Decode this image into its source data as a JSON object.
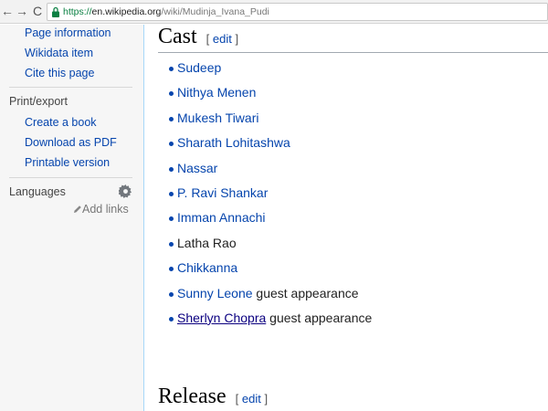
{
  "browser": {
    "back_glyph": "←",
    "forward_glyph": "→",
    "reload_glyph": "C",
    "url_scheme": "https://",
    "url_host": "en.wikipedia.org",
    "url_path": "/wiki/Mudinja_Ivana_Pudi"
  },
  "sidebar": {
    "tools_links": [
      "Page information",
      "Wikidata item",
      "Cite this page"
    ],
    "print_heading": "Print/export",
    "print_links": [
      "Create a book",
      "Download as PDF",
      "Printable version"
    ],
    "languages_heading": "Languages",
    "add_links": "Add links"
  },
  "content": {
    "cast_title": "Cast",
    "cast_edit_open": "[",
    "cast_edit": "edit",
    "cast_edit_close": "]",
    "cast": [
      {
        "name": "Sudeep",
        "suffix": ""
      },
      {
        "name": "Nithya Menen",
        "suffix": ""
      },
      {
        "name": "Mukesh Tiwari",
        "suffix": ""
      },
      {
        "name": "Sharath Lohitashwa",
        "suffix": ""
      },
      {
        "name": "Nassar",
        "suffix": ""
      },
      {
        "name": "P. Ravi Shankar",
        "suffix": ""
      },
      {
        "name": "Imman Annachi",
        "suffix": ""
      },
      {
        "name": "Latha Rao",
        "suffix": ""
      },
      {
        "name": "Chikkanna",
        "suffix": ""
      },
      {
        "name": "Sunny Leone",
        "suffix": " guest appearance"
      },
      {
        "name": "Sherlyn Chopra",
        "suffix": " guest appearance"
      }
    ],
    "release_title": "Release",
    "release_edit_open": "[",
    "release_edit": "edit",
    "release_edit_close": "]"
  },
  "colors": {
    "link": "#0645ad",
    "sidebar_bg": "#f6f6f6",
    "content_border": "#a7d7f9"
  }
}
